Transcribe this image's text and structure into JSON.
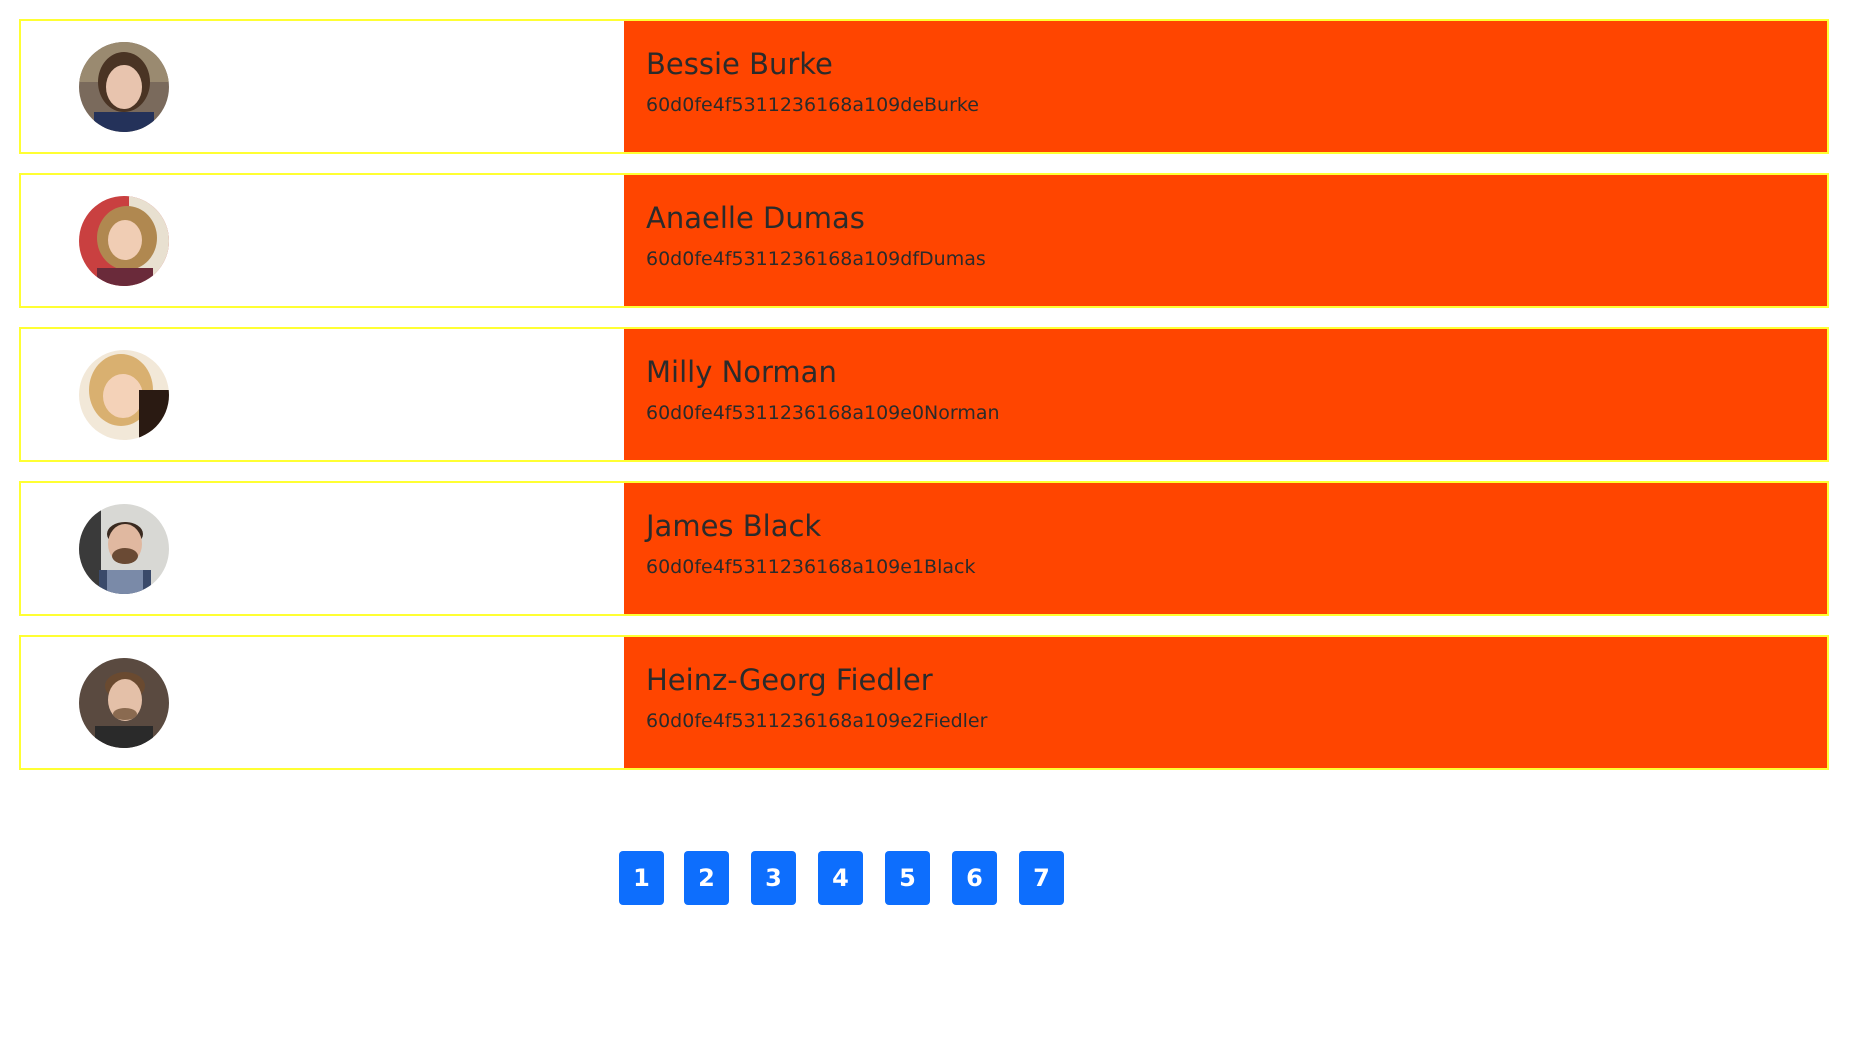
{
  "users": [
    {
      "name": "Bessie Burke",
      "id": "60d0fe4f5311236168a109deBurke",
      "avatar_icon": "avatar-woman-dark-hair"
    },
    {
      "name": "Anaelle Dumas",
      "id": "60d0fe4f5311236168a109dfDumas",
      "avatar_icon": "avatar-woman-curly-hair"
    },
    {
      "name": "Milly Norman",
      "id": "60d0fe4f5311236168a109e0Norman",
      "avatar_icon": "avatar-woman-blonde"
    },
    {
      "name": "James Black",
      "id": "60d0fe4f5311236168a109e1Black",
      "avatar_icon": "avatar-man-beard"
    },
    {
      "name": "Heinz-Georg Fiedler",
      "id": "60d0fe4f5311236168a109e2Fiedler",
      "avatar_icon": "avatar-man-brown-hair"
    }
  ],
  "pagination": {
    "pages": [
      "1",
      "2",
      "3",
      "4",
      "5",
      "6",
      "7"
    ]
  },
  "colors": {
    "row_border": "#ffff33",
    "info_background": "#ff4500",
    "page_button": "#0d6efd"
  }
}
